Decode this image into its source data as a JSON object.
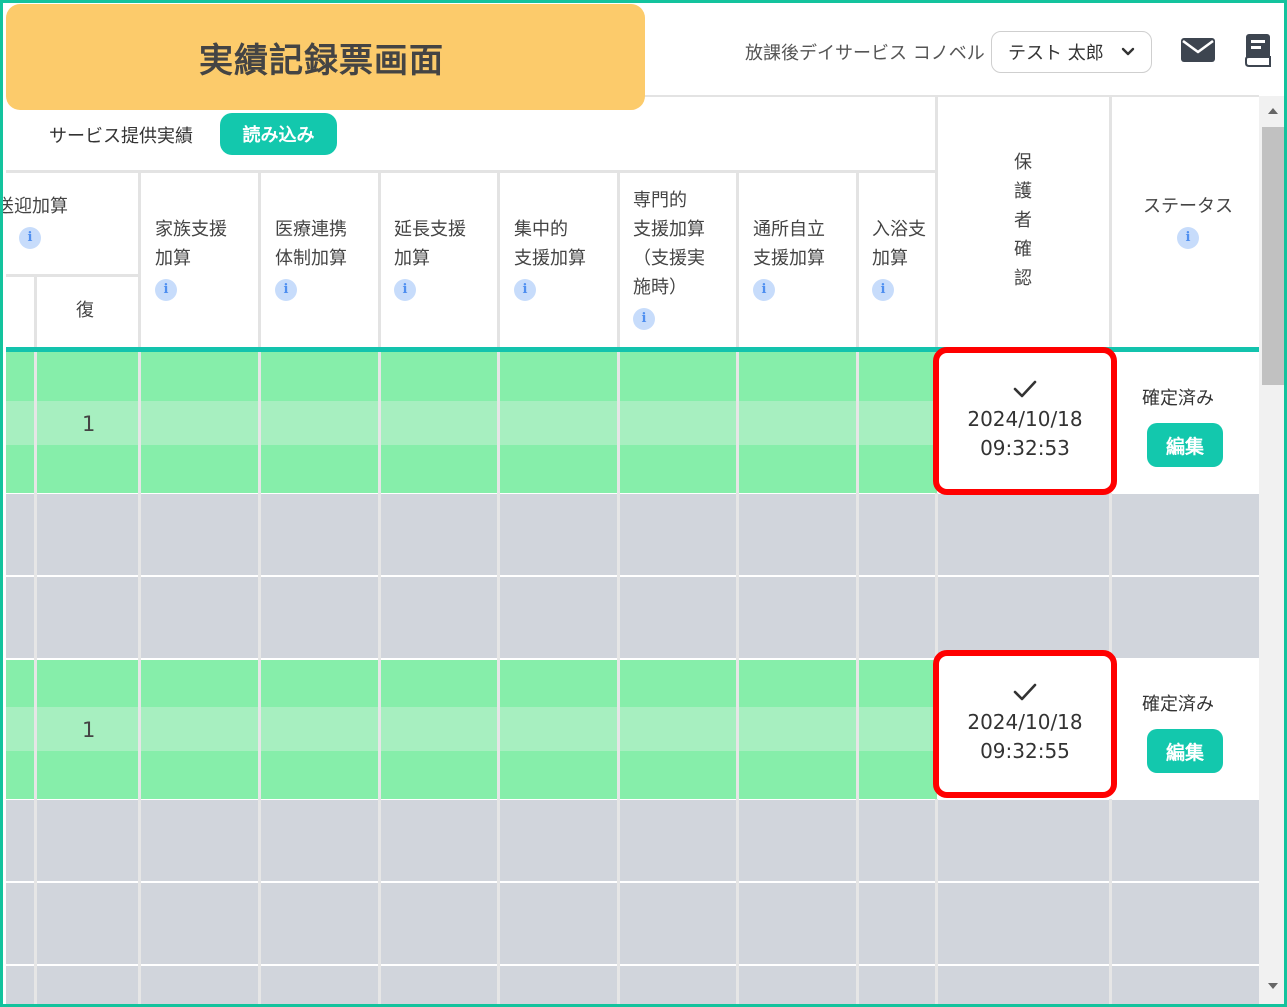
{
  "page_title": "実績記録票画面",
  "facility_name": "放課後デイサービス コノベル",
  "user_select": {
    "value": "テスト 太郎"
  },
  "section": {
    "label": "サービス提供実績",
    "load_button": "読み込み"
  },
  "columns": {
    "transport": "送迎加算",
    "transport_sub": "復",
    "family_support": [
      "家族支援",
      "加算"
    ],
    "medical": [
      "医療連携",
      "体制加算"
    ],
    "extended": [
      "延長支援",
      "加算"
    ],
    "intensive": [
      "集中的",
      "支援加算"
    ],
    "specialist": [
      "専門的",
      "支援加算",
      "（支援実",
      "施時）"
    ],
    "commute": [
      "通所自立",
      "支援加算"
    ],
    "bathing": [
      "入浴支",
      "加算"
    ],
    "guardian": [
      "保",
      "護",
      "者",
      "確",
      "認"
    ],
    "status": "ステータス",
    "info_glyph": "i"
  },
  "rows": [
    {
      "count": "1",
      "confirmed_date": "2024/10/18",
      "confirmed_time": "09:32:53",
      "status": "確定済み",
      "edit_label": "編集"
    },
    {
      "count": "1",
      "confirmed_date": "2024/10/18",
      "confirmed_time": "09:32:55",
      "status": "確定済み",
      "edit_label": "編集"
    }
  ],
  "colors": {
    "accent": "#13c8ad",
    "banner": "#fccb6b",
    "highlight": "#ff0000",
    "row_green": "#86eeaa",
    "row_gray": "#d1d5dc"
  }
}
